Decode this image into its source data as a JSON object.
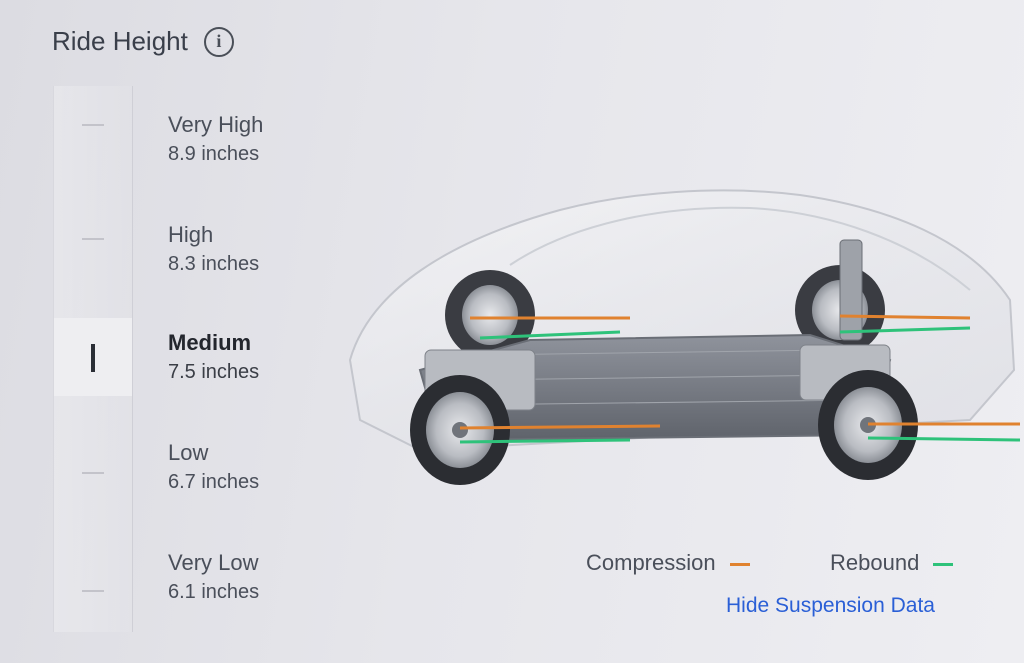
{
  "header": {
    "title": "Ride Height",
    "info_icon": "info-icon"
  },
  "levels": [
    {
      "name": "Very High",
      "value": "8.9 inches",
      "selected": false
    },
    {
      "name": "High",
      "value": "8.3 inches",
      "selected": false
    },
    {
      "name": "Medium",
      "value": "7.5 inches",
      "selected": true
    },
    {
      "name": "Low",
      "value": "6.7 inches",
      "selected": false
    },
    {
      "name": "Very Low",
      "value": "6.1 inches",
      "selected": false
    }
  ],
  "legend": {
    "compression": {
      "label": "Compression",
      "color": "#e0822f"
    },
    "rebound": {
      "label": "Rebound",
      "color": "#2ec27a"
    }
  },
  "actions": {
    "hide_label": "Hide Suspension Data"
  }
}
